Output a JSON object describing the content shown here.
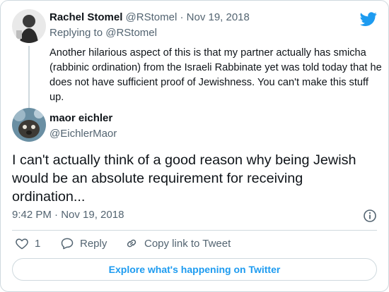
{
  "parent_tweet": {
    "author_name": "Rachel Stomel",
    "author_handle": "@RStomel",
    "separator": "·",
    "date": "Nov 19, 2018",
    "replying_prefix": "Replying to ",
    "replying_to": "@RStomel",
    "text": "Another hilarious aspect of this is that my partner actually has smicha (rabbinic ordination) from the Israeli Rabbinate yet was told today that he does not have sufficient proof of Jewishness. You can't make this stuff up."
  },
  "main_tweet": {
    "author_name": "maor eichler",
    "author_handle": "@EichlerMaor",
    "text": "I can't actually think of a good reason why being Jewish would be an absolute requirement for receiving ordination...",
    "timestamp": "9:42 PM · Nov 19, 2018"
  },
  "actions": {
    "like_count": "1",
    "reply_label": "Reply",
    "copy_link_label": "Copy link to Tweet"
  },
  "explore_button": "Explore what's happening on Twitter",
  "colors": {
    "twitter_blue": "#1d9bf0",
    "muted_text": "#536471",
    "border": "#cfd9de"
  },
  "icons": [
    "twitter-bird-icon",
    "info-icon",
    "heart-icon",
    "reply-bubble-icon",
    "link-icon"
  ]
}
